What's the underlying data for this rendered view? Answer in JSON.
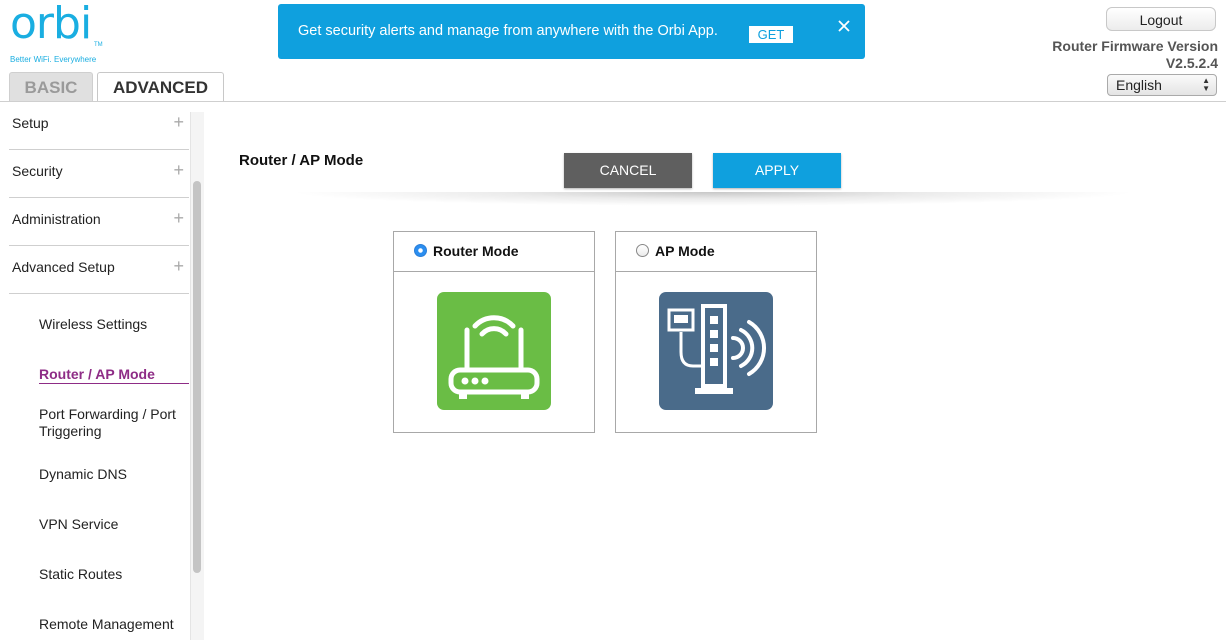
{
  "logo": {
    "wordmark": "orbi",
    "tm": "TM",
    "tagline": "Better WiFi. Everywhere"
  },
  "banner": {
    "text": "Get security alerts and manage from anywhere with the Orbi App.",
    "get_label": "GET"
  },
  "header": {
    "logout_label": "Logout",
    "firmware_label": "Router Firmware Version",
    "firmware_version": "V2.5.2.4",
    "language": "English"
  },
  "tabs": {
    "basic": "BASIC",
    "advanced": "ADVANCED"
  },
  "sidebar": {
    "menus": [
      {
        "label": "Setup"
      },
      {
        "label": "Security"
      },
      {
        "label": "Administration"
      },
      {
        "label": "Advanced Setup"
      }
    ],
    "sub_items": [
      {
        "label": "Wireless Settings"
      },
      {
        "label": "Router / AP Mode"
      },
      {
        "label": "Port Forwarding / Port Triggering"
      },
      {
        "label": "Dynamic DNS"
      },
      {
        "label": "VPN Service"
      },
      {
        "label": "Static Routes"
      },
      {
        "label": "Remote Management"
      }
    ],
    "active_item": "Router / AP Mode"
  },
  "content": {
    "page_title": "Router / AP Mode",
    "cancel_label": "CANCEL",
    "apply_label": "APPLY",
    "modes": [
      {
        "label": "Router Mode",
        "selected": true,
        "icon": "router-icon"
      },
      {
        "label": "AP Mode",
        "selected": false,
        "icon": "access-point-icon"
      }
    ]
  },
  "colors": {
    "brand_blue": "#0fa0de",
    "active_purple": "#8e2c86",
    "router_green": "#6abd45",
    "ap_slate": "#4a6b8a",
    "cancel_gray": "#5f5f5f"
  }
}
